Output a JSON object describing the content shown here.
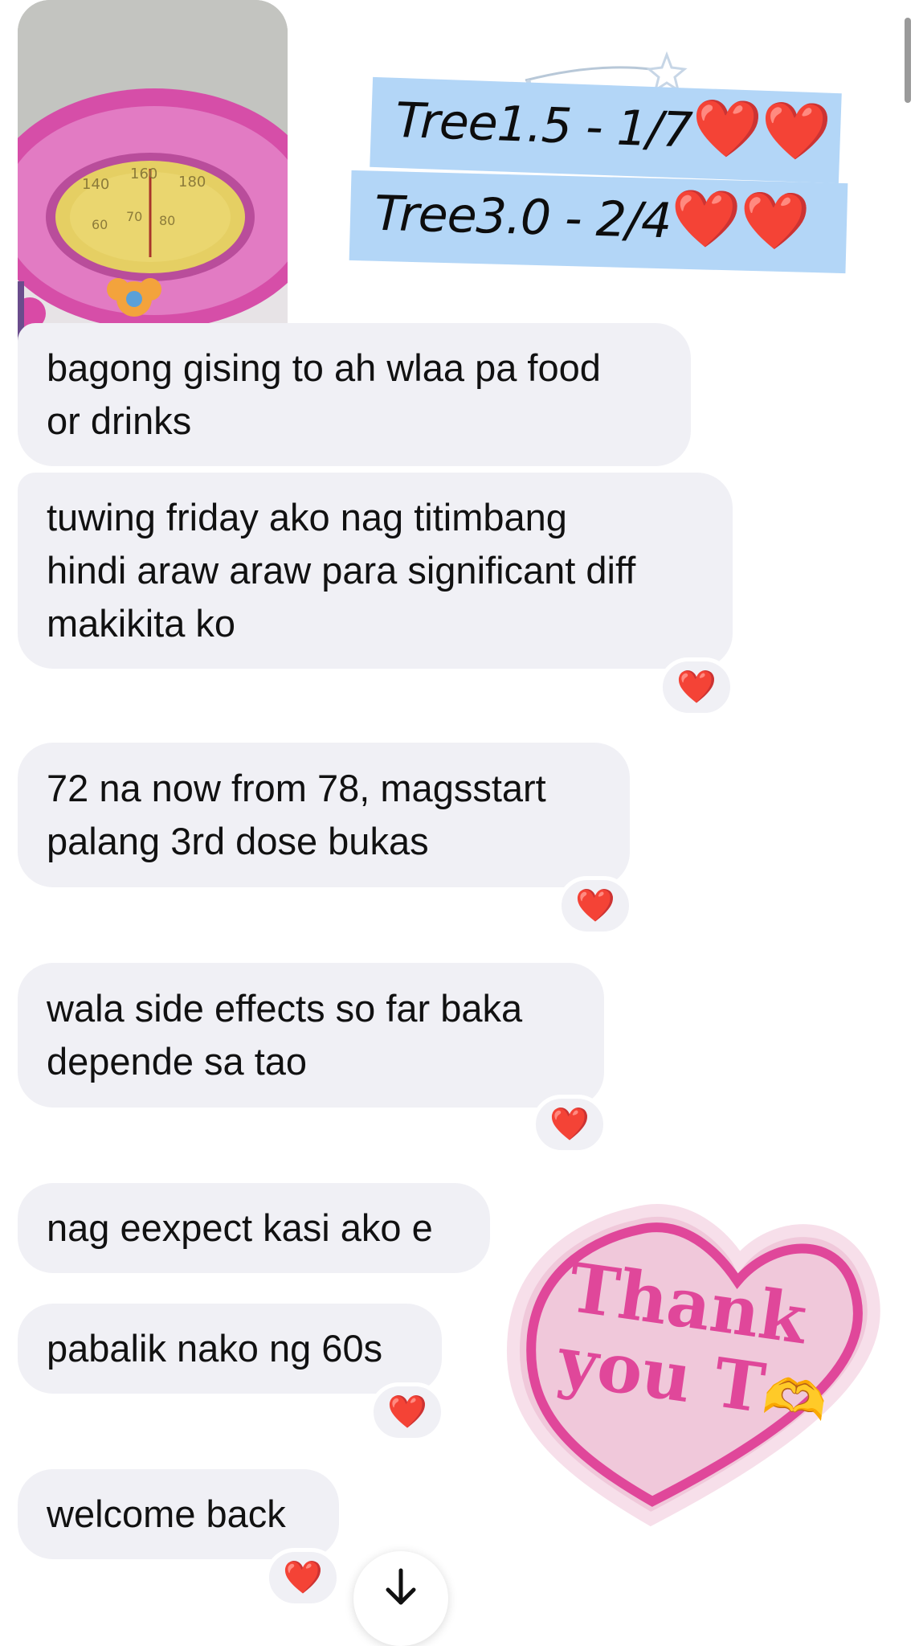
{
  "chat": {
    "photo": {
      "description": "bathroom scale photo"
    },
    "tree_sticker": {
      "line1": "Tree1.5 - 1/7",
      "line2": "Tree3.0 - 2/4",
      "hearts": "❤️❤️"
    },
    "messages": [
      {
        "lines": [
          "bagong gising to ah wlaa pa food",
          "or drinks"
        ],
        "reaction": null
      },
      {
        "lines": [
          "tuwing friday ako nag titimbang",
          "hindi araw araw para significant diff",
          "makikita ko"
        ],
        "reaction": "❤️"
      },
      {
        "lines": [
          "72 na now from 78, magsstart",
          "palang 3rd dose bukas"
        ],
        "reaction": "❤️"
      },
      {
        "lines": [
          "wala side effects so far baka",
          "depende sa tao"
        ],
        "reaction": "❤️"
      },
      {
        "lines": [
          "nag eexpect kasi ako e"
        ],
        "reaction": null
      },
      {
        "lines": [
          "pabalik nako ng 60s"
        ],
        "reaction": "❤️"
      },
      {
        "lines": [
          "welcome back"
        ],
        "reaction": "❤️"
      }
    ],
    "thank_sticker": {
      "line1": "Thank",
      "line2": "you T",
      "emoji": "🫶"
    }
  },
  "colors": {
    "bubble": "#f0f0f5",
    "sticker_blue": "#b3d6f7",
    "heart_pink": "#e0479a",
    "heart_fill": "#f3c8dc"
  },
  "icons": {
    "scroll_down": "arrow-down-icon"
  }
}
